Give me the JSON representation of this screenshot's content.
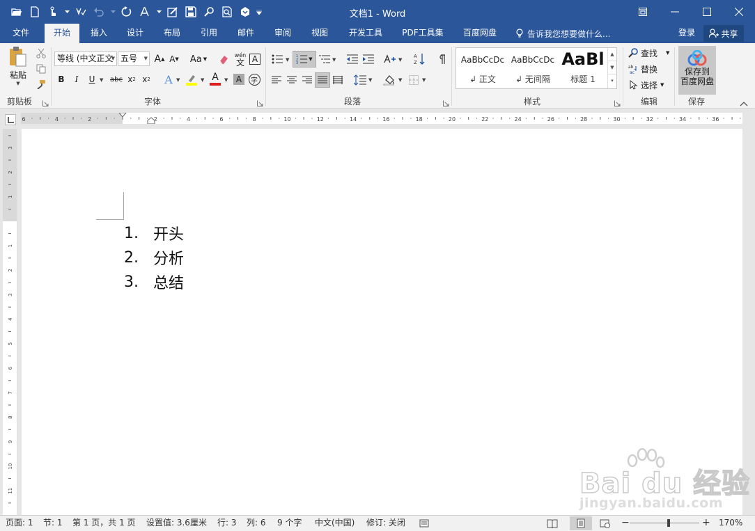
{
  "app": {
    "title": "文档1 - Word",
    "accent": "#2b579a"
  },
  "qat": {
    "icons": [
      "open-icon",
      "new-doc-icon",
      "touch-mode-icon",
      "spelling-icon",
      "undo-icon",
      "redo-icon",
      "format-icon",
      "track-icon",
      "save-icon",
      "find-icon",
      "print-preview-icon",
      "heart-icon",
      "customize-icon"
    ]
  },
  "tabs": [
    {
      "label": "文件"
    },
    {
      "label": "开始",
      "active": true
    },
    {
      "label": "插入"
    },
    {
      "label": "设计"
    },
    {
      "label": "布局"
    },
    {
      "label": "引用"
    },
    {
      "label": "邮件"
    },
    {
      "label": "审阅"
    },
    {
      "label": "视图"
    },
    {
      "label": "开发工具"
    },
    {
      "label": "PDF工具集"
    },
    {
      "label": "百度网盘"
    }
  ],
  "tell_me": "告诉我您想要做什么...",
  "login": "登录",
  "share": "共享",
  "ribbon": {
    "clipboard": {
      "paste": "粘贴",
      "label": "剪贴板"
    },
    "font": {
      "name": "等线 (中文正文",
      "size": "五号",
      "label": "字体",
      "grow": "A",
      "shrink": "A",
      "case": "Aa",
      "bold": "B",
      "italic": "I",
      "underline": "U",
      "strike": "abc",
      "sub": "x",
      "sup": "x",
      "phonetic": "wén",
      "phonetic_char": "文",
      "border_char": "A",
      "shade_char": "A",
      "enclose_char": "字"
    },
    "paragraph": {
      "label": "段落"
    },
    "styles": {
      "label": "样式",
      "items": [
        {
          "preview": "AaBbCcDc",
          "name": "↲ 正文"
        },
        {
          "preview": "AaBbCcDc",
          "name": "↲ 无间隔"
        },
        {
          "preview": "AaBl",
          "name": "标题 1"
        }
      ]
    },
    "editing": {
      "label": "编辑",
      "find": "查找",
      "replace": "替换",
      "select": "选择"
    },
    "save": {
      "label": "保存",
      "button_line1": "保存到",
      "button_line2": "百度网盘"
    }
  },
  "ruler": {
    "h_ticks": [
      "6",
      "4",
      "2",
      "2",
      "4",
      "6",
      "8",
      "10",
      "12",
      "14",
      "16",
      "18",
      "20",
      "22",
      "24",
      "26",
      "28",
      "30",
      "32",
      "34",
      "36"
    ],
    "v_ticks": [
      "3",
      "2",
      "1",
      "1",
      "2",
      "3",
      "4",
      "5",
      "6",
      "7",
      "8",
      "9",
      "10",
      "11",
      "12"
    ]
  },
  "document": {
    "list": [
      {
        "num": "1.",
        "text": "开头"
      },
      {
        "num": "2.",
        "text": "分析"
      },
      {
        "num": "3.",
        "text": "总结"
      }
    ]
  },
  "watermark": {
    "text": "Bai du 经验",
    "url": "jingyan.baidu.com"
  },
  "status": {
    "page": "页面: 1",
    "section": "节: 1",
    "pages": "第 1 页，共 1 页",
    "position": "设置值: 3.6厘米",
    "line": "行: 3",
    "col": "列: 6",
    "words": "9 个字",
    "lang": "中文(中国)",
    "track": "修订: 关闭",
    "zoom": "170%",
    "zoom_level": 170
  }
}
